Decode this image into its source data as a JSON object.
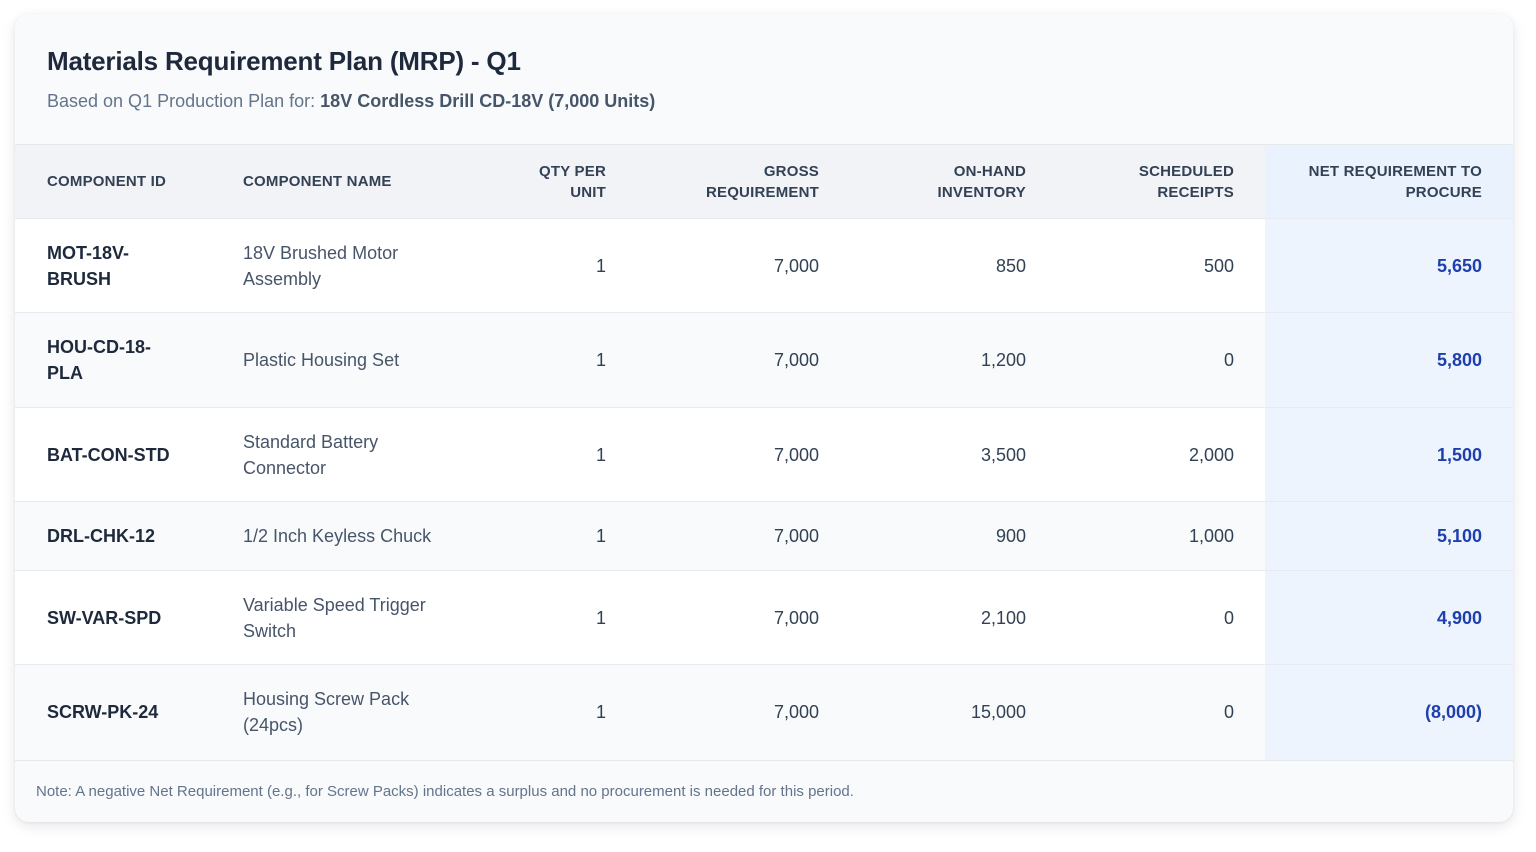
{
  "report": {
    "title": "Materials Requirement Plan (MRP) - Q1",
    "subtitle_prefix": "Based on Q1 Production Plan for: ",
    "subtitle_product": "18V Cordless Drill CD-18V (7,000 Units)"
  },
  "table": {
    "headers": [
      "COMPONENT ID",
      "COMPONENT NAME",
      "QTY PER UNIT",
      "GROSS REQUIREMENT",
      "ON-HAND INVENTORY",
      "SCHEDULED RECEIPTS",
      "NET REQUIREMENT TO PROCURE"
    ],
    "rows": [
      {
        "id": "MOT-18V-BRUSH",
        "name": "18V Brushed Motor Assembly",
        "qty": "1",
        "gross": "7,000",
        "onhand": "850",
        "scheduled": "500",
        "net": "5,650"
      },
      {
        "id": "HOU-CD-18-PLA",
        "name": "Plastic Housing Set",
        "qty": "1",
        "gross": "7,000",
        "onhand": "1,200",
        "scheduled": "0",
        "net": "5,800"
      },
      {
        "id": "BAT-CON-STD",
        "name": "Standard Battery Connector",
        "qty": "1",
        "gross": "7,000",
        "onhand": "3,500",
        "scheduled": "2,000",
        "net": "1,500"
      },
      {
        "id": "DRL-CHK-12",
        "name": "1/2 Inch Keyless Chuck",
        "qty": "1",
        "gross": "7,000",
        "onhand": "900",
        "scheduled": "1,000",
        "net": "5,100"
      },
      {
        "id": "SW-VAR-SPD",
        "name": "Variable Speed Trigger Switch",
        "qty": "1",
        "gross": "7,000",
        "onhand": "2,100",
        "scheduled": "0",
        "net": "4,900"
      },
      {
        "id": "SCRW-PK-24",
        "name": "Housing Screw Pack (24pcs)",
        "qty": "1",
        "gross": "7,000",
        "onhand": "15,000",
        "scheduled": "0",
        "net": "(8,000)"
      }
    ]
  },
  "note": "Note: A negative Net Requirement (e.g., for Screw Packs) indicates a surplus and no procurement is needed for this period.",
  "colors": {
    "accent_net": "#1e40af",
    "net_column_bg": "#eef4fd",
    "header_bg": "#f1f3f6"
  }
}
